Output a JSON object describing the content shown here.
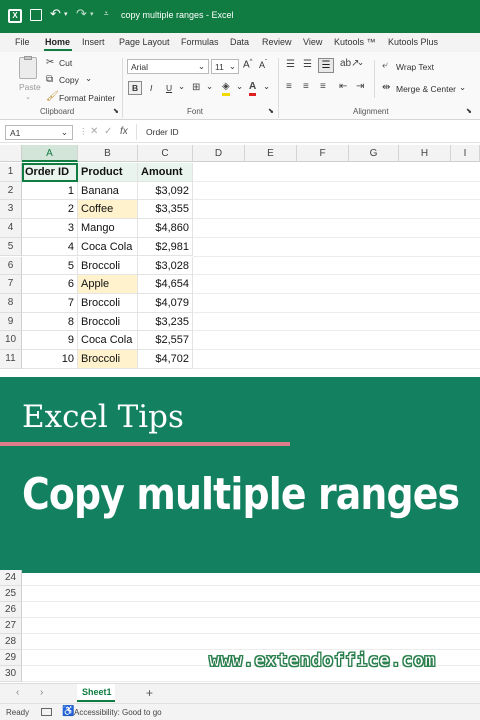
{
  "window": {
    "title": "copy multiple ranges  -  Excel",
    "accent": "#107c41"
  },
  "menu": {
    "tabs": [
      "File",
      "Home",
      "Insert",
      "Page Layout",
      "Formulas",
      "Data",
      "Review",
      "View",
      "Kutools ™",
      "Kutools Plus"
    ],
    "active": "Home"
  },
  "ribbon": {
    "clipboard": {
      "paste": "Paste",
      "cut": "Cut",
      "copy": "Copy",
      "format_painter": "Format Painter",
      "group": "Clipboard"
    },
    "font": {
      "name": "Arial",
      "size": "11",
      "bold": "B",
      "italic": "I",
      "underline": "U",
      "group": "Font"
    },
    "alignment": {
      "wrap_text": "Wrap Text",
      "merge_center": "Merge & Center",
      "group": "Alignment"
    }
  },
  "formula_bar": {
    "name_box": "A1",
    "fx": "fx",
    "content": "Order ID"
  },
  "sheet": {
    "columns": [
      "A",
      "B",
      "C",
      "D",
      "E",
      "F",
      "G",
      "H",
      "I"
    ],
    "header": [
      "Order ID",
      "Product",
      "Amount"
    ],
    "rows": [
      {
        "row": "1"
      },
      {
        "row": "2",
        "id": "1",
        "product": "Banana",
        "amount": "$3,092"
      },
      {
        "row": "3",
        "id": "2",
        "product": "Coffee",
        "amount": "$3,355",
        "hl": true
      },
      {
        "row": "4",
        "id": "3",
        "product": "Mango",
        "amount": "$4,860"
      },
      {
        "row": "5",
        "id": "4",
        "product": "Coca Cola",
        "amount": "$2,981"
      },
      {
        "row": "6",
        "id": "5",
        "product": "Broccoli",
        "amount": "$3,028"
      },
      {
        "row": "7",
        "id": "6",
        "product": "Apple",
        "amount": "$4,654",
        "hl": true
      },
      {
        "row": "8",
        "id": "7",
        "product": "Broccoli",
        "amount": "$4,079"
      },
      {
        "row": "9",
        "id": "8",
        "product": "Broccoli",
        "amount": "$3,235"
      },
      {
        "row": "10",
        "id": "9",
        "product": "Coca Cola",
        "amount": "$2,557"
      },
      {
        "row": "11",
        "id": "10",
        "product": "Broccoli",
        "amount": "$4,702",
        "hl": true
      }
    ],
    "lower_rows": [
      "24",
      "25",
      "26",
      "27",
      "28",
      "29",
      "30"
    ]
  },
  "banner": {
    "kicker": "Excel Tips",
    "title": "Copy multiple ranges",
    "bg_color": "#13805f",
    "line_color": "#e07b8a"
  },
  "watermark": "www.extendoffice.com",
  "sheet_tabs": {
    "active": "Sheet1",
    "add": "+"
  },
  "status": {
    "ready": "Ready",
    "accessibility": "Accessibility: Good to go"
  }
}
